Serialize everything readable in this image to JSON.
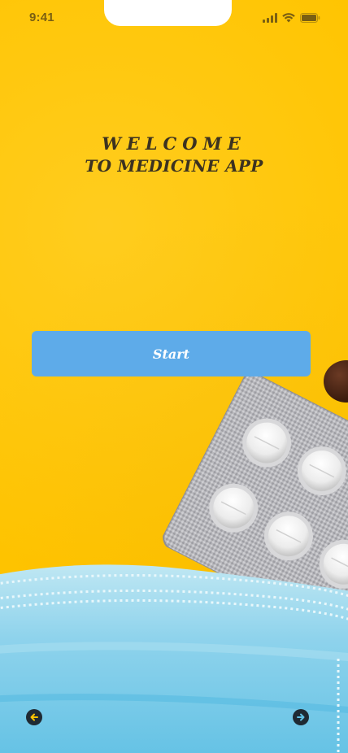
{
  "status_bar": {
    "time": "9:41"
  },
  "welcome": {
    "line1": "WELCOME",
    "line2": "TO MEDICINE APP"
  },
  "start_button": {
    "label": "Start"
  },
  "nav": {
    "back_icon": "arrow-left-icon",
    "forward_icon": "arrow-right-icon"
  },
  "colors": {
    "background": "#ffc400",
    "button": "#5eabe9",
    "heading": "#3c3220",
    "nav_icon": "#1f2a33"
  }
}
